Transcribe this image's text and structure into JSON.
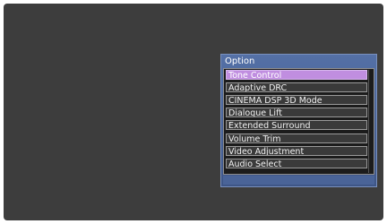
{
  "panel": {
    "title": "Option",
    "selected_index": 0,
    "items": [
      {
        "label": "Tone Control"
      },
      {
        "label": "Adaptive DRC"
      },
      {
        "label": "CINEMA DSP 3D Mode"
      },
      {
        "label": "Dialogue Lift"
      },
      {
        "label": "Extended Surround"
      },
      {
        "label": "Volume Trim"
      },
      {
        "label": "Video Adjustment"
      },
      {
        "label": "Audio Select"
      }
    ]
  },
  "colors": {
    "screen_background": "#3d3d3d",
    "panel_blue": "#4a6498",
    "selection_highlight": "#c08ee0"
  }
}
